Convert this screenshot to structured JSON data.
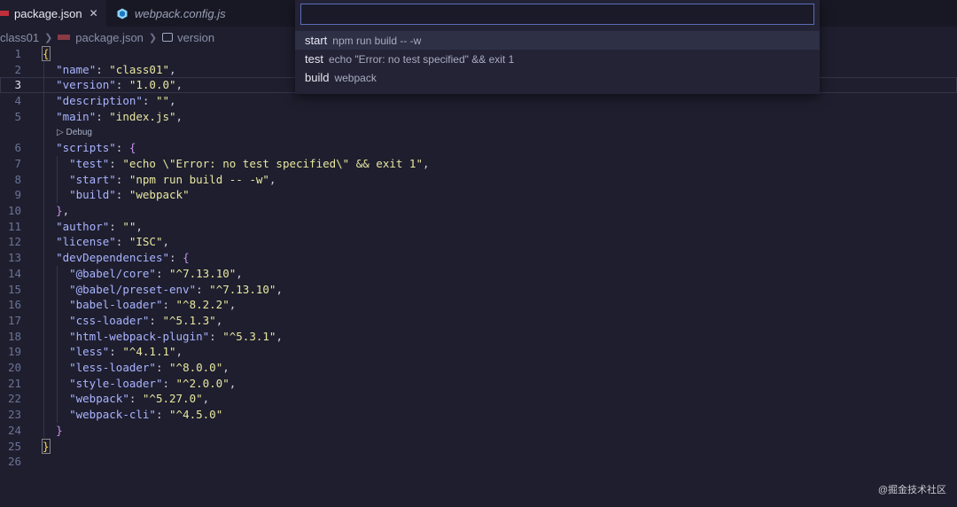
{
  "tabs": [
    {
      "label": "package.json",
      "close": "✕"
    },
    {
      "label": "webpack.config.js"
    }
  ],
  "breadcrumb": [
    "class01",
    "package.json",
    "version"
  ],
  "quick_pick": {
    "input_value": "",
    "items": [
      {
        "name": "start",
        "detail": "npm run build -- -w"
      },
      {
        "name": "test",
        "detail": "echo \"Error: no test specified\" && exit 1"
      },
      {
        "name": "build",
        "detail": "webpack"
      }
    ]
  },
  "codelens": "▷ Debug",
  "editor": {
    "current_line": 3,
    "lines": [
      {
        "n": "1",
        "t": [
          [
            "bm",
            "{"
          ]
        ]
      },
      {
        "n": "2",
        "t": [
          [
            "p",
            "  "
          ],
          [
            "k",
            "\"name\""
          ],
          [
            "p",
            ": "
          ],
          [
            "s",
            "\"class01\""
          ],
          [
            "p",
            ","
          ]
        ]
      },
      {
        "n": "3",
        "t": [
          [
            "p",
            "  "
          ],
          [
            "k",
            "\"version\""
          ],
          [
            "p",
            ": "
          ],
          [
            "s",
            "\"1.0.0\""
          ],
          [
            "p",
            ","
          ]
        ]
      },
      {
        "n": "4",
        "t": [
          [
            "p",
            "  "
          ],
          [
            "k",
            "\"description\""
          ],
          [
            "p",
            ": "
          ],
          [
            "s",
            "\"\""
          ],
          [
            "p",
            ","
          ]
        ]
      },
      {
        "n": "5",
        "t": [
          [
            "p",
            "  "
          ],
          [
            "k",
            "\"main\""
          ],
          [
            "p",
            ": "
          ],
          [
            "s",
            "\"index.js\""
          ],
          [
            "p",
            ","
          ]
        ]
      },
      {
        "n": "6",
        "t": [
          [
            "p",
            "  "
          ],
          [
            "k",
            "\"scripts\""
          ],
          [
            "p",
            ": "
          ],
          [
            "b",
            "{"
          ]
        ]
      },
      {
        "n": "7",
        "t": [
          [
            "p",
            "    "
          ],
          [
            "k",
            "\"test\""
          ],
          [
            "p",
            ": "
          ],
          [
            "s",
            "\"echo \\\"Error: no test specified\\\" && exit 1\""
          ],
          [
            "p",
            ","
          ]
        ]
      },
      {
        "n": "8",
        "t": [
          [
            "p",
            "    "
          ],
          [
            "k",
            "\"start\""
          ],
          [
            "p",
            ": "
          ],
          [
            "s",
            "\"npm run build -- -w\""
          ],
          [
            "p",
            ","
          ]
        ]
      },
      {
        "n": "9",
        "t": [
          [
            "p",
            "    "
          ],
          [
            "k",
            "\"build\""
          ],
          [
            "p",
            ": "
          ],
          [
            "s",
            "\"webpack\""
          ]
        ]
      },
      {
        "n": "10",
        "t": [
          [
            "p",
            "  "
          ],
          [
            "b",
            "}"
          ],
          [
            "p",
            ","
          ]
        ]
      },
      {
        "n": "11",
        "t": [
          [
            "p",
            "  "
          ],
          [
            "k",
            "\"author\""
          ],
          [
            "p",
            ": "
          ],
          [
            "s",
            "\"\""
          ],
          [
            "p",
            ","
          ]
        ]
      },
      {
        "n": "12",
        "t": [
          [
            "p",
            "  "
          ],
          [
            "k",
            "\"license\""
          ],
          [
            "p",
            ": "
          ],
          [
            "s",
            "\"ISC\""
          ],
          [
            "p",
            ","
          ]
        ]
      },
      {
        "n": "13",
        "t": [
          [
            "p",
            "  "
          ],
          [
            "k",
            "\"devDependencies\""
          ],
          [
            "p",
            ": "
          ],
          [
            "b",
            "{"
          ]
        ]
      },
      {
        "n": "14",
        "t": [
          [
            "p",
            "    "
          ],
          [
            "k",
            "\"@babel/core\""
          ],
          [
            "p",
            ": "
          ],
          [
            "s",
            "\"^7.13.10\""
          ],
          [
            "p",
            ","
          ]
        ]
      },
      {
        "n": "15",
        "t": [
          [
            "p",
            "    "
          ],
          [
            "k",
            "\"@babel/preset-env\""
          ],
          [
            "p",
            ": "
          ],
          [
            "s",
            "\"^7.13.10\""
          ],
          [
            "p",
            ","
          ]
        ]
      },
      {
        "n": "16",
        "t": [
          [
            "p",
            "    "
          ],
          [
            "k",
            "\"babel-loader\""
          ],
          [
            "p",
            ": "
          ],
          [
            "s",
            "\"^8.2.2\""
          ],
          [
            "p",
            ","
          ]
        ]
      },
      {
        "n": "17",
        "t": [
          [
            "p",
            "    "
          ],
          [
            "k",
            "\"css-loader\""
          ],
          [
            "p",
            ": "
          ],
          [
            "s",
            "\"^5.1.3\""
          ],
          [
            "p",
            ","
          ]
        ]
      },
      {
        "n": "18",
        "t": [
          [
            "p",
            "    "
          ],
          [
            "k",
            "\"html-webpack-plugin\""
          ],
          [
            "p",
            ": "
          ],
          [
            "s",
            "\"^5.3.1\""
          ],
          [
            "p",
            ","
          ]
        ]
      },
      {
        "n": "19",
        "t": [
          [
            "p",
            "    "
          ],
          [
            "k",
            "\"less\""
          ],
          [
            "p",
            ": "
          ],
          [
            "s",
            "\"^4.1.1\""
          ],
          [
            "p",
            ","
          ]
        ]
      },
      {
        "n": "20",
        "t": [
          [
            "p",
            "    "
          ],
          [
            "k",
            "\"less-loader\""
          ],
          [
            "p",
            ": "
          ],
          [
            "s",
            "\"^8.0.0\""
          ],
          [
            "p",
            ","
          ]
        ]
      },
      {
        "n": "21",
        "t": [
          [
            "p",
            "    "
          ],
          [
            "k",
            "\"style-loader\""
          ],
          [
            "p",
            ": "
          ],
          [
            "s",
            "\"^2.0.0\""
          ],
          [
            "p",
            ","
          ]
        ]
      },
      {
        "n": "22",
        "t": [
          [
            "p",
            "    "
          ],
          [
            "k",
            "\"webpack\""
          ],
          [
            "p",
            ": "
          ],
          [
            "s",
            "\"^5.27.0\""
          ],
          [
            "p",
            ","
          ]
        ]
      },
      {
        "n": "23",
        "t": [
          [
            "p",
            "    "
          ],
          [
            "k",
            "\"webpack-cli\""
          ],
          [
            "p",
            ": "
          ],
          [
            "s",
            "\"^4.5.0\""
          ]
        ]
      },
      {
        "n": "24",
        "t": [
          [
            "p",
            "  "
          ],
          [
            "b",
            "}"
          ]
        ]
      },
      {
        "n": "25",
        "t": [
          [
            "bm",
            "}"
          ]
        ]
      },
      {
        "n": "26",
        "t": []
      }
    ]
  },
  "watermark": "@掘金技术社区"
}
